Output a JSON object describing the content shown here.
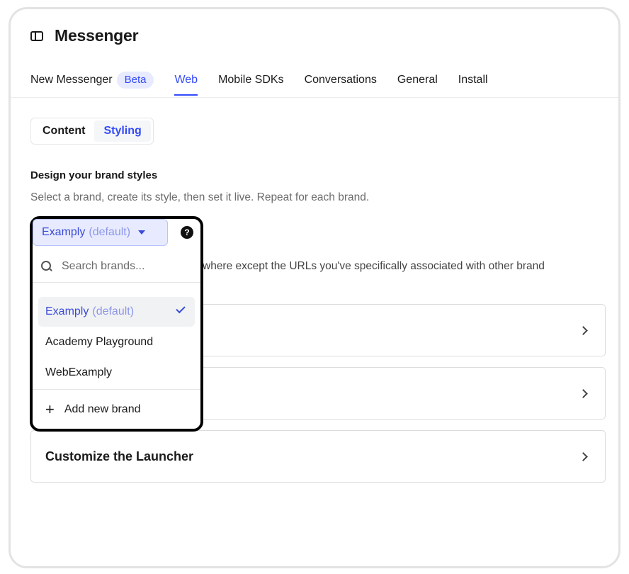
{
  "header": {
    "title": "Messenger",
    "icon": "sidebar-panel-icon"
  },
  "tabs": [
    {
      "label": "New Messenger",
      "badge": "Beta"
    },
    {
      "label": "Web",
      "active": true
    },
    {
      "label": "Mobile SDKs"
    },
    {
      "label": "Conversations"
    },
    {
      "label": "General"
    },
    {
      "label": "Install"
    }
  ],
  "segmented": {
    "content": "Content",
    "styling": "Styling",
    "active": "Styling"
  },
  "section": {
    "title": "Design your brand styles",
    "description": "Select a brand, create its style, then set it live. Repeat for each brand.",
    "brand_scope_text": "where except the URLs you've specifically associated with other brand"
  },
  "brand_select": {
    "name": "Examply",
    "default_tag": "(default)"
  },
  "dropdown": {
    "search_placeholder": "Search brands...",
    "options": [
      {
        "name": "Examply",
        "tag": "(default)",
        "selected": true
      },
      {
        "name": "Academy Playground"
      },
      {
        "name": "WebExamply"
      }
    ],
    "add_label": "Add new brand"
  },
  "cards": [
    {
      "label": ""
    },
    {
      "label": ""
    },
    {
      "label": "Customize the Launcher"
    }
  ],
  "colors": {
    "accent": "#334bfa",
    "accent_light": "#e8ebff",
    "border": "#dcdcdc"
  }
}
